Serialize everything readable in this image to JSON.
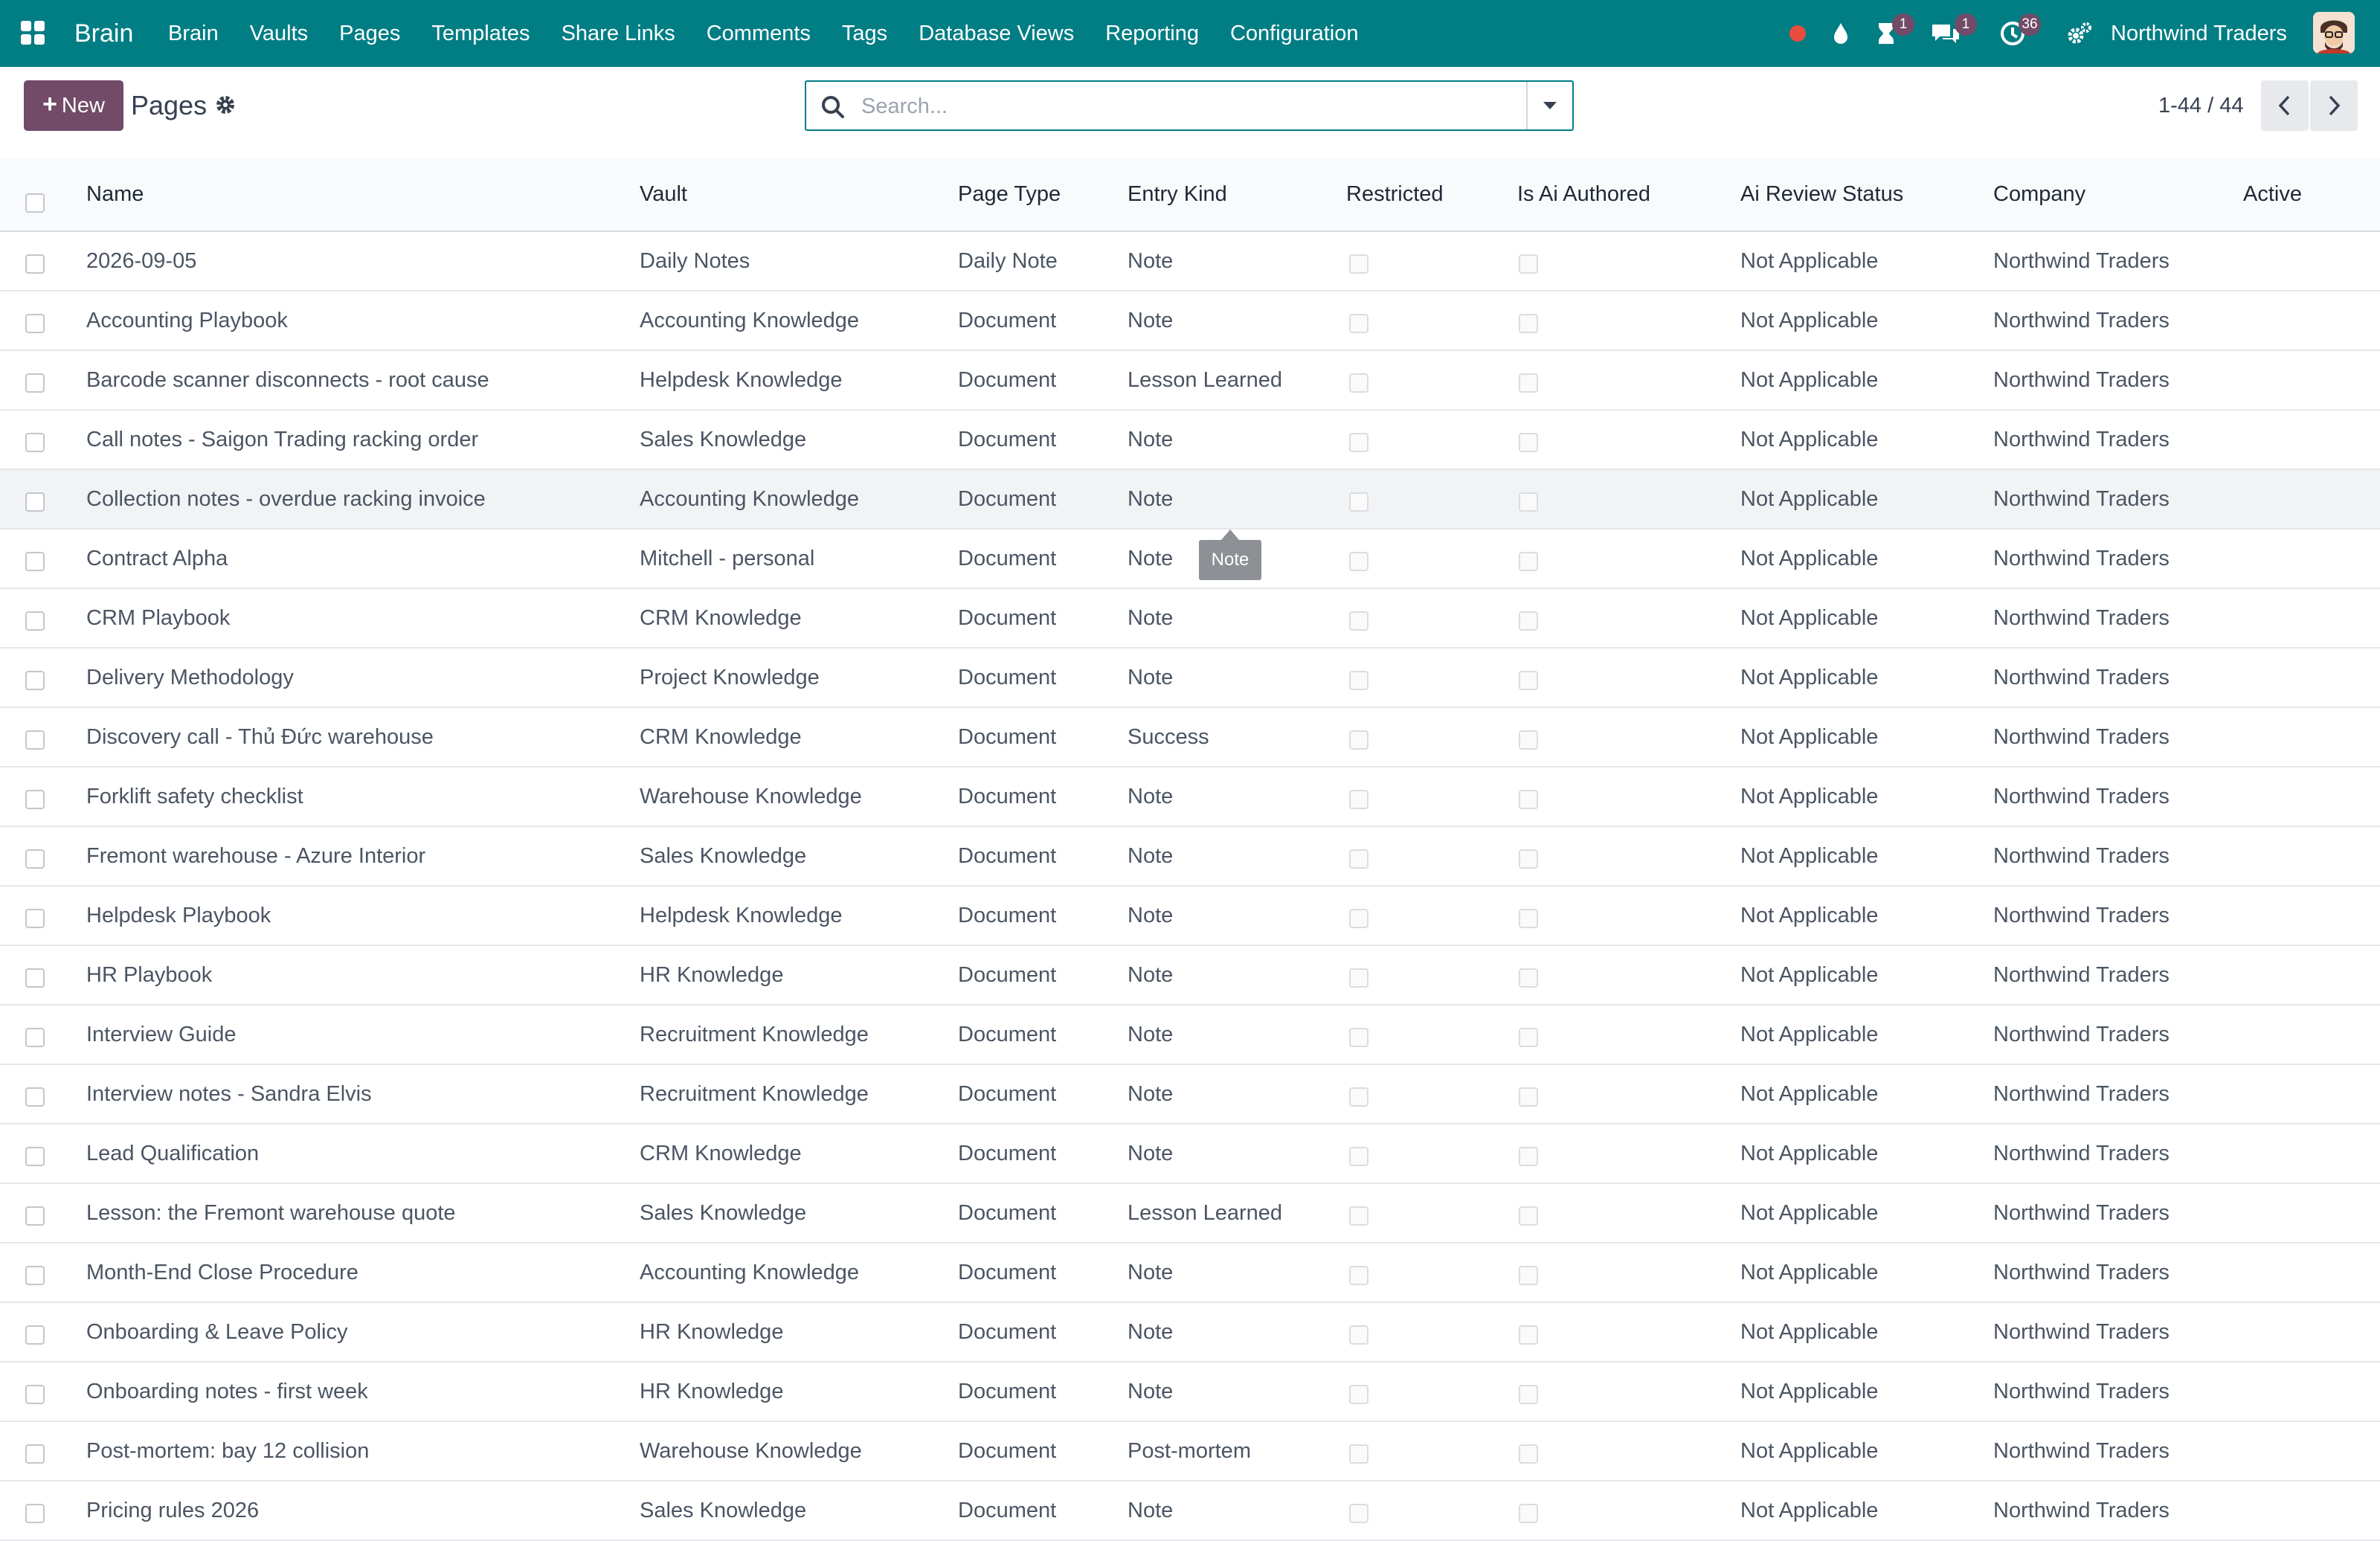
{
  "navbar": {
    "app_name": "Brain",
    "menu": [
      "Brain",
      "Vaults",
      "Pages",
      "Templates",
      "Share Links",
      "Comments",
      "Tags",
      "Database Views",
      "Reporting",
      "Configuration"
    ],
    "badges": {
      "activities": "1",
      "messages": "1",
      "clock": "36"
    },
    "company": "Northwind Traders",
    "colors": {
      "bar": "#017e84",
      "badge": "#714b67",
      "status_dot": "#e74c3c"
    }
  },
  "control": {
    "new_label": "New",
    "title": "Pages",
    "search_placeholder": "Search...",
    "pager": "1-44 / 44"
  },
  "table": {
    "columns": {
      "name": "Name",
      "vault": "Vault",
      "page_type": "Page Type",
      "entry_kind": "Entry Kind",
      "restricted": "Restricted",
      "ai_authored": "Is Ai Authored",
      "ai_review": "Ai Review Status",
      "company": "Company",
      "active": "Active"
    },
    "rows": [
      {
        "name": "2026-09-05",
        "vault": "Daily Notes",
        "page_type": "Daily Note",
        "entry_kind": "Note",
        "ai_review": "Not Applicable",
        "company": "Northwind Traders"
      },
      {
        "name": "Accounting Playbook",
        "vault": "Accounting Knowledge",
        "page_type": "Document",
        "entry_kind": "Note",
        "ai_review": "Not Applicable",
        "company": "Northwind Traders"
      },
      {
        "name": "Barcode scanner disconnects - root cause",
        "vault": "Helpdesk Knowledge",
        "page_type": "Document",
        "entry_kind": "Lesson Learned",
        "ai_review": "Not Applicable",
        "company": "Northwind Traders"
      },
      {
        "name": "Call notes - Saigon Trading racking order",
        "vault": "Sales Knowledge",
        "page_type": "Document",
        "entry_kind": "Note",
        "ai_review": "Not Applicable",
        "company": "Northwind Traders"
      },
      {
        "name": "Collection notes - overdue racking invoice",
        "vault": "Accounting Knowledge",
        "page_type": "Document",
        "entry_kind": "Note",
        "ai_review": "Not Applicable",
        "company": "Northwind Traders"
      },
      {
        "name": "Contract Alpha",
        "vault": "Mitchell - personal",
        "page_type": "Document",
        "entry_kind": "Note",
        "ai_review": "Not Applicable",
        "company": "Northwind Traders"
      },
      {
        "name": "CRM Playbook",
        "vault": "CRM Knowledge",
        "page_type": "Document",
        "entry_kind": "Note",
        "ai_review": "Not Applicable",
        "company": "Northwind Traders"
      },
      {
        "name": "Delivery Methodology",
        "vault": "Project Knowledge",
        "page_type": "Document",
        "entry_kind": "Note",
        "ai_review": "Not Applicable",
        "company": "Northwind Traders"
      },
      {
        "name": "Discovery call - Thủ Đức warehouse",
        "vault": "CRM Knowledge",
        "page_type": "Document",
        "entry_kind": "Success",
        "ai_review": "Not Applicable",
        "company": "Northwind Traders"
      },
      {
        "name": "Forklift safety checklist",
        "vault": "Warehouse Knowledge",
        "page_type": "Document",
        "entry_kind": "Note",
        "ai_review": "Not Applicable",
        "company": "Northwind Traders"
      },
      {
        "name": "Fremont warehouse - Azure Interior",
        "vault": "Sales Knowledge",
        "page_type": "Document",
        "entry_kind": "Note",
        "ai_review": "Not Applicable",
        "company": "Northwind Traders"
      },
      {
        "name": "Helpdesk Playbook",
        "vault": "Helpdesk Knowledge",
        "page_type": "Document",
        "entry_kind": "Note",
        "ai_review": "Not Applicable",
        "company": "Northwind Traders"
      },
      {
        "name": "HR Playbook",
        "vault": "HR Knowledge",
        "page_type": "Document",
        "entry_kind": "Note",
        "ai_review": "Not Applicable",
        "company": "Northwind Traders"
      },
      {
        "name": "Interview Guide",
        "vault": "Recruitment Knowledge",
        "page_type": "Document",
        "entry_kind": "Note",
        "ai_review": "Not Applicable",
        "company": "Northwind Traders"
      },
      {
        "name": "Interview notes - Sandra Elvis",
        "vault": "Recruitment Knowledge",
        "page_type": "Document",
        "entry_kind": "Note",
        "ai_review": "Not Applicable",
        "company": "Northwind Traders"
      },
      {
        "name": "Lead Qualification",
        "vault": "CRM Knowledge",
        "page_type": "Document",
        "entry_kind": "Note",
        "ai_review": "Not Applicable",
        "company": "Northwind Traders"
      },
      {
        "name": "Lesson: the Fremont warehouse quote",
        "vault": "Sales Knowledge",
        "page_type": "Document",
        "entry_kind": "Lesson Learned",
        "ai_review": "Not Applicable",
        "company": "Northwind Traders"
      },
      {
        "name": "Month-End Close Procedure",
        "vault": "Accounting Knowledge",
        "page_type": "Document",
        "entry_kind": "Note",
        "ai_review": "Not Applicable",
        "company": "Northwind Traders"
      },
      {
        "name": "Onboarding & Leave Policy",
        "vault": "HR Knowledge",
        "page_type": "Document",
        "entry_kind": "Note",
        "ai_review": "Not Applicable",
        "company": "Northwind Traders"
      },
      {
        "name": "Onboarding notes - first week",
        "vault": "HR Knowledge",
        "page_type": "Document",
        "entry_kind": "Note",
        "ai_review": "Not Applicable",
        "company": "Northwind Traders"
      },
      {
        "name": "Post-mortem: bay 12 collision",
        "vault": "Warehouse Knowledge",
        "page_type": "Document",
        "entry_kind": "Post-mortem",
        "ai_review": "Not Applicable",
        "company": "Northwind Traders"
      },
      {
        "name": "Pricing rules 2026",
        "vault": "Sales Knowledge",
        "page_type": "Document",
        "entry_kind": "Note",
        "ai_review": "Not Applicable",
        "company": "Northwind Traders"
      }
    ]
  },
  "tooltip": {
    "text": "Note"
  }
}
